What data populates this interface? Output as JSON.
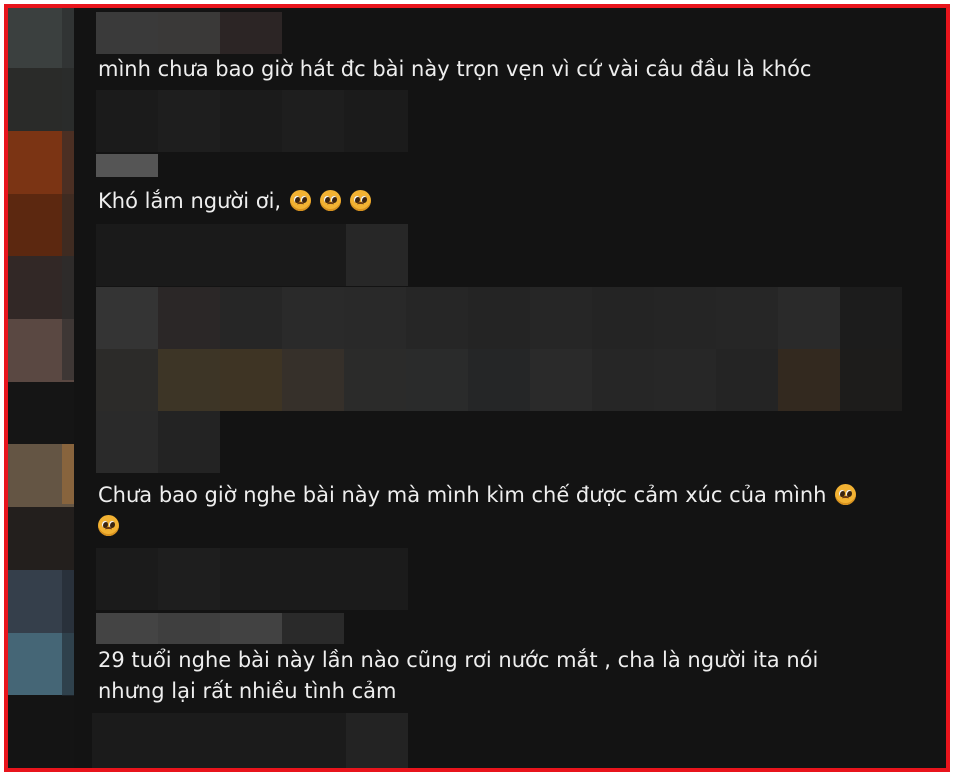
{
  "comments": [
    {
      "text": "mình chưa bao giờ hát đc bài này trọn vẹn vì cứ vài câu đầu là khóc",
      "emoji": []
    },
    {
      "text": "Khó lắm người ơi,",
      "emoji": [
        "pleading-face-icon",
        "pleading-face-icon",
        "pleading-face-icon"
      ]
    },
    {
      "text": "Chưa bao giờ nghe bài này mà mình kìm chế được cảm xúc của mình",
      "emoji": [
        "pleading-face-icon",
        "pleading-face-icon"
      ]
    },
    {
      "line1": "29 tuổi nghe bài này lần nào cũng rơi nước mắt , cha là người ita nói",
      "line2": "nhưng lại rất nhiều tình cảm"
    }
  ],
  "colors": {
    "frame": "#e8141c",
    "background": "#131313",
    "text": "#eeeeee"
  }
}
